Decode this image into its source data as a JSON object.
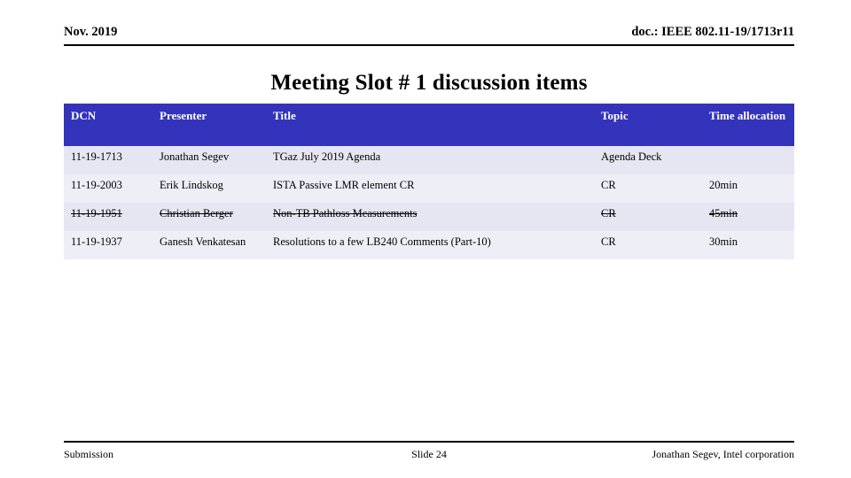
{
  "header": {
    "date": "Nov. 2019",
    "doc": "doc.: IEEE 802.11-19/1713r11"
  },
  "title": "Meeting Slot # 1 discussion items",
  "table": {
    "columns": [
      "DCN",
      "Presenter",
      "Title",
      "Topic",
      "Time allocation"
    ],
    "rows": [
      {
        "dcn": "11-19-1713",
        "presenter": "Jonathan Segev",
        "title": "TGaz July 2019 Agenda",
        "topic": "Agenda Deck",
        "time": "",
        "struck": false
      },
      {
        "dcn": "11-19-2003",
        "presenter": "Erik Lindskog",
        "title": "ISTA Passive LMR element CR",
        "topic": "CR",
        "time": "20min",
        "struck": false
      },
      {
        "dcn": "11-19-1951",
        "presenter": "Christian Berger",
        "title": "Non-TB Pathloss Measurements",
        "topic": "CR",
        "time": "45min",
        "struck": true
      },
      {
        "dcn": "11-19-1937",
        "presenter": "Ganesh Venkatesan",
        "title": "Resolutions to a few LB240 Comments (Part-10)",
        "topic": "CR",
        "time": "30min",
        "struck": false
      }
    ]
  },
  "footer": {
    "left": "Submission",
    "center": "Slide 24",
    "right": "Jonathan Segev, Intel corporation"
  },
  "colors": {
    "header_fill": "#3333bb",
    "row_a": "#e6e6f2",
    "row_b": "#eeeef7"
  }
}
